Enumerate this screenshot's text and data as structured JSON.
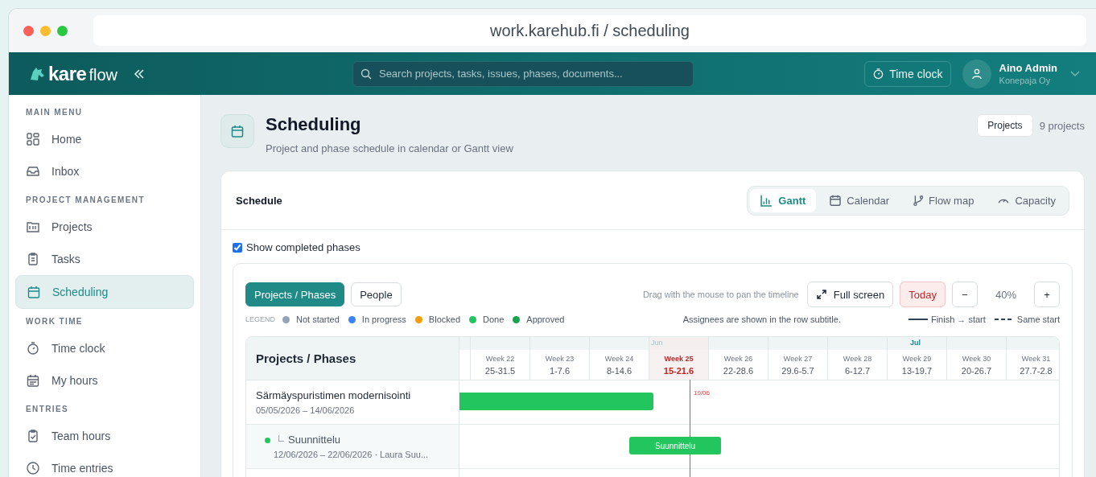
{
  "browser": {
    "url": "work.karehub.fi / scheduling"
  },
  "header": {
    "logo": {
      "bold": "kare",
      "light": "flow"
    },
    "search": {
      "placeholder": "Search projects, tasks, issues, phases, documents..."
    },
    "time_clock": "Time clock",
    "user": {
      "name": "Aino Admin",
      "company": "Konepaja Oy"
    }
  },
  "sidebar": {
    "sections": [
      {
        "title": "MAIN MENU",
        "items": [
          {
            "label": "Home",
            "selected": false
          },
          {
            "label": "Inbox",
            "selected": false
          }
        ]
      },
      {
        "title": "PROJECT MANAGEMENT",
        "items": [
          {
            "label": "Projects",
            "selected": false
          },
          {
            "label": "Tasks",
            "selected": false
          },
          {
            "label": "Scheduling",
            "selected": true
          }
        ]
      },
      {
        "title": "WORK TIME",
        "items": [
          {
            "label": "Time clock",
            "selected": false
          },
          {
            "label": "My hours",
            "selected": false
          }
        ]
      },
      {
        "title": "ENTRIES",
        "items": [
          {
            "label": "Team hours",
            "selected": false
          },
          {
            "label": "Time entries",
            "selected": false
          }
        ]
      }
    ]
  },
  "page": {
    "title": "Scheduling",
    "subtitle": "Project and phase schedule in calendar or Gantt view",
    "projects_button": "Projects",
    "project_count": "9 projects"
  },
  "schedule": {
    "title": "Schedule",
    "tabs": [
      {
        "label": "Gantt",
        "selected": true
      },
      {
        "label": "Calendar",
        "selected": false
      },
      {
        "label": "Flow map",
        "selected": false
      },
      {
        "label": "Capacity",
        "selected": false
      }
    ],
    "show_completed": {
      "label": "Show completed phases",
      "checked": true
    },
    "view_toggle": [
      {
        "label": "Projects / Phases",
        "selected": true
      },
      {
        "label": "People",
        "selected": false
      }
    ],
    "drag_hint": "Drag with the mouse to pan the timeline",
    "full_screen": "Full screen",
    "today": "Today",
    "zoom_out": "−",
    "zoom": "40%",
    "zoom_in": "+",
    "legend_title": "LEGEND",
    "legend": [
      {
        "label": "Not started",
        "color": "#94a3b8"
      },
      {
        "label": "In progress",
        "color": "#3b82f6"
      },
      {
        "label": "Blocked",
        "color": "#f59e0b"
      },
      {
        "label": "Done",
        "color": "#22c55e"
      },
      {
        "label": "Approved",
        "color": "#16a34a"
      }
    ],
    "assignee_note": "Assignees are shown in the row subtitle.",
    "link_legend": [
      {
        "label": "Finish → start",
        "kind": "solid"
      },
      {
        "label": "Same start",
        "kind": "dashed"
      }
    ],
    "gantt": {
      "column_title": "Projects / Phases",
      "weeks": [
        {
          "week": "Week 22",
          "dates": "25-31.5",
          "current": false
        },
        {
          "week": "Week 23",
          "dates": "1-7.6",
          "current": false
        },
        {
          "week": "Week 24",
          "dates": "8-14.6",
          "current": false
        },
        {
          "week": "Week 25",
          "dates": "15-21.6",
          "current": true,
          "month": "Jun"
        },
        {
          "week": "Week 26",
          "dates": "22-28.6",
          "current": false
        },
        {
          "week": "Week 27",
          "dates": "29.6-5.7",
          "current": false
        },
        {
          "week": "Week 28",
          "dates": "6-12.7",
          "current": false
        },
        {
          "week": "Week 29",
          "dates": "13-19.7",
          "current": false,
          "month": "Jul"
        },
        {
          "week": "Week 30",
          "dates": "20-26.7",
          "current": false
        },
        {
          "week": "Week 31",
          "dates": "27.7-2.8",
          "current": false
        }
      ],
      "today_label": "19/06",
      "rows": [
        {
          "kind": "project",
          "name": "Särmäyspuristimen modernisointi",
          "dates": "05/05/2026 – 14/06/2026",
          "color": "#22c55e"
        },
        {
          "kind": "phase",
          "name": "Suunnittelu",
          "dates": "12/06/2026 – 22/06/2026 · Laura Suu...",
          "color": "#22c55e",
          "bar_label": "Suunnittelu"
        }
      ]
    }
  }
}
